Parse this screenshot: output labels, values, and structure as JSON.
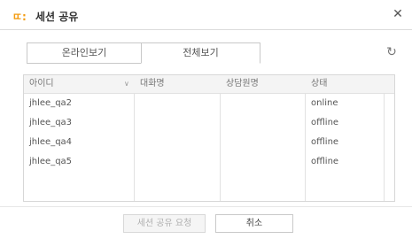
{
  "header": {
    "logo": "ㄸ:",
    "title": "세션 공유",
    "close_glyph": "✕"
  },
  "tabs": [
    {
      "label": "온라인보기"
    },
    {
      "label": "전체보기",
      "selected": true
    }
  ],
  "refresh_glyph": "↻",
  "table": {
    "columns": [
      "아이디",
      "대화명",
      "상담원명",
      "상태"
    ],
    "sort_glyph": "∨",
    "rows": [
      {
        "id": "jhlee_qa2",
        "nickname": "",
        "agent": "",
        "status": "online"
      },
      {
        "id": "jhlee_qa3",
        "nickname": "",
        "agent": "",
        "status": "offline"
      },
      {
        "id": "jhlee_qa4",
        "nickname": "",
        "agent": "",
        "status": "offline"
      },
      {
        "id": "jhlee_qa5",
        "nickname": "",
        "agent": "",
        "status": "offline"
      }
    ]
  },
  "footer": {
    "request_label": "세션 공유 요청",
    "request_disabled": true,
    "cancel_label": "취소"
  },
  "colors": {
    "accent": "#f39c12",
    "header_bg": "#f4f4f4",
    "border": "#d7d7d7"
  }
}
